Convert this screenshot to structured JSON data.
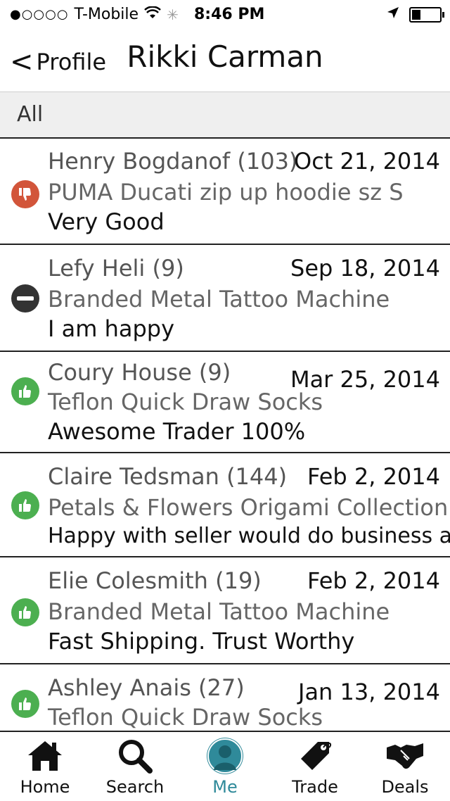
{
  "status": {
    "carrier": "T-Mobile",
    "time": "8:46 PM"
  },
  "nav": {
    "back_label": "Profile",
    "title": "Rikki Carman"
  },
  "filter": {
    "label": "All"
  },
  "colors": {
    "negative": "#d2553a",
    "neutral": "#333333",
    "positive": "#4caf50",
    "active_tab": "#2f8a9a"
  },
  "feedback": [
    {
      "rating": "negative",
      "name": "Henry Bogdanof (103)",
      "date": "Oct 21, 2014",
      "item": "PUMA Ducati zip up hoodie sz S",
      "comment": "Very Good"
    },
    {
      "rating": "neutral",
      "name": "Lefy Heli (9)",
      "date": "Sep 18, 2014",
      "item": "Branded Metal Tattoo Machine",
      "comment": "I am happy"
    },
    {
      "rating": "positive",
      "name": "Coury House (9)",
      "date": "Mar 25, 2014",
      "item": "Teflon Quick Draw Socks",
      "comment": "Awesome Trader 100%"
    },
    {
      "rating": "positive",
      "name": "Claire Tedsman (144)",
      "date": "Feb 2, 2014",
      "item": "Petals & Flowers Origami Collection",
      "comment": "Happy with seller would do business again"
    },
    {
      "rating": "positive",
      "name": "Elie Colesmith (19)",
      "date": "Feb 2, 2014",
      "item": "Branded Metal Tattoo Machine",
      "comment": "Fast Shipping. Trust Worthy"
    },
    {
      "rating": "positive",
      "name": "Ashley Anais (27)",
      "date": "Jan 13, 2014",
      "item": "Teflon Quick Draw Socks",
      "comment": ""
    }
  ],
  "tabs": [
    {
      "label": "Home",
      "icon": "home-icon"
    },
    {
      "label": "Search",
      "icon": "search-icon"
    },
    {
      "label": "Me",
      "icon": "user-icon"
    },
    {
      "label": "Trade",
      "icon": "tag-icon"
    },
    {
      "label": "Deals",
      "icon": "handshake-icon"
    }
  ]
}
